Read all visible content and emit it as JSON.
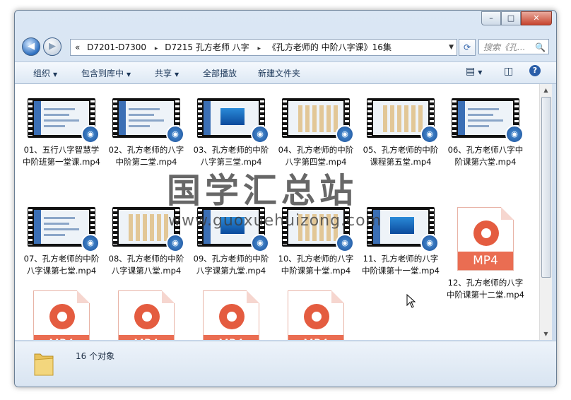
{
  "window": {
    "caption_buttons": {
      "minimize": "–",
      "maximize": "□",
      "close": "✕"
    }
  },
  "nav": {
    "back_icon": "◀",
    "forward_icon": "▶",
    "address": {
      "chevron": "«",
      "segments": [
        "D7201-D7300",
        "D7215 孔方老师 八字",
        "《孔方老师的 中阶八字课》16集"
      ],
      "separator": "▸"
    },
    "search_placeholder": "搜索《孔...",
    "search_icon": "🔍",
    "refresh_icon": "⟳"
  },
  "toolbar": {
    "organize": "组织",
    "include_in_library": "包含到库中",
    "share": "共享",
    "play_all": "全部播放",
    "new_folder": "新建文件夹"
  },
  "files": [
    {
      "label": "01、五行八字智慧学中阶班第一堂课.mp4",
      "kind": "video",
      "thumb": "blue"
    },
    {
      "label": "02、孔方老师的八字中阶第二堂.mp4",
      "kind": "video",
      "thumb": "blue"
    },
    {
      "label": "03、孔方老师的中阶八字第三堂.mp4",
      "kind": "video",
      "thumb": "win7"
    },
    {
      "label": "04、孔方老师的中阶八字第四堂.mp4",
      "kind": "video",
      "thumb": "grid"
    },
    {
      "label": "05、孔方老师的中阶课程第五堂.mp4",
      "kind": "video",
      "thumb": "grid"
    },
    {
      "label": "06、孔方老师八字中阶课第六堂.mp4",
      "kind": "video",
      "thumb": "blue"
    },
    {
      "label": "07、孔方老师的中阶八字课第七堂.mp4",
      "kind": "video",
      "thumb": "blue"
    },
    {
      "label": "08、孔方老师的中阶八字课第八堂.mp4",
      "kind": "video",
      "thumb": "grid"
    },
    {
      "label": "09、孔方老师的中阶八字课第九堂.mp4",
      "kind": "video",
      "thumb": "win7"
    },
    {
      "label": "10、孔方老师的八字中阶课第十堂.mp4",
      "kind": "video",
      "thumb": "grid"
    },
    {
      "label": "11、孔方老师的八字中阶课第十一堂.mp4",
      "kind": "video",
      "thumb": "win7"
    },
    {
      "label": "12、孔方老师的八字中阶课第十二堂.mp4",
      "kind": "mp4",
      "thumb": ""
    },
    {
      "label": "",
      "kind": "mp4",
      "thumb": ""
    },
    {
      "label": "",
      "kind": "mp4",
      "thumb": ""
    },
    {
      "label": "",
      "kind": "mp4",
      "thumb": ""
    },
    {
      "label": "",
      "kind": "mp4",
      "thumb": ""
    }
  ],
  "mp4_badge": "MP4",
  "status": {
    "count": "16 个对象"
  },
  "watermark": {
    "title": "国学汇总站",
    "url": "www.guoxuehuizong.com"
  }
}
